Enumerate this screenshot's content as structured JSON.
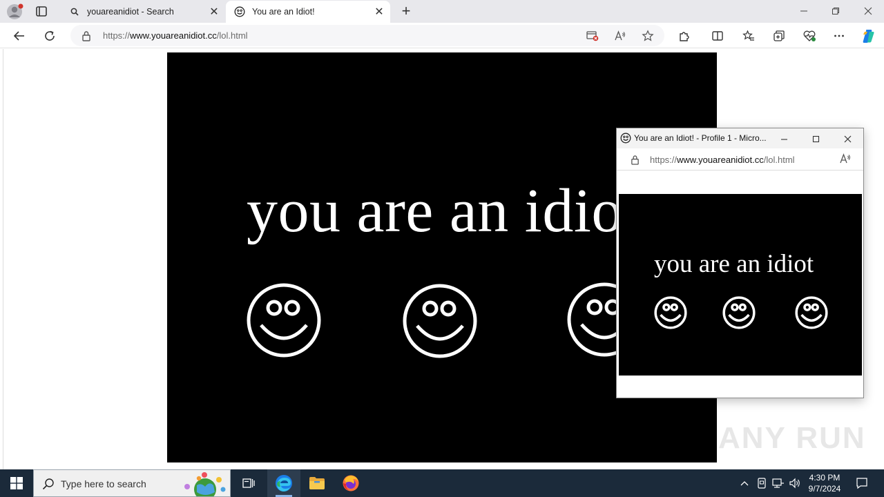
{
  "browser": {
    "tabs": [
      {
        "label": "youareanidiot - Search",
        "icon": "search-icon"
      },
      {
        "label": "You are an Idiot!",
        "icon": "smiley-icon",
        "active": true
      }
    ],
    "address": {
      "url_prefix": "https://",
      "url_host": "www.youareanidiot.cc",
      "url_path": "/lol.html"
    }
  },
  "page": {
    "headline": "you are an idiot",
    "background": "#000000",
    "text_color": "#ffffff"
  },
  "popup": {
    "title": "You are an Idiot! - Profile 1 - Micro...",
    "url_prefix": "https://",
    "url_host": "www.youareanidiot.cc",
    "url_path": "/lol.html",
    "headline": "you are an idiot"
  },
  "watermark": {
    "text": "ANY RUN"
  },
  "taskbar": {
    "search_placeholder": "Type here to search",
    "time": "4:30 PM",
    "date": "9/7/2024"
  }
}
